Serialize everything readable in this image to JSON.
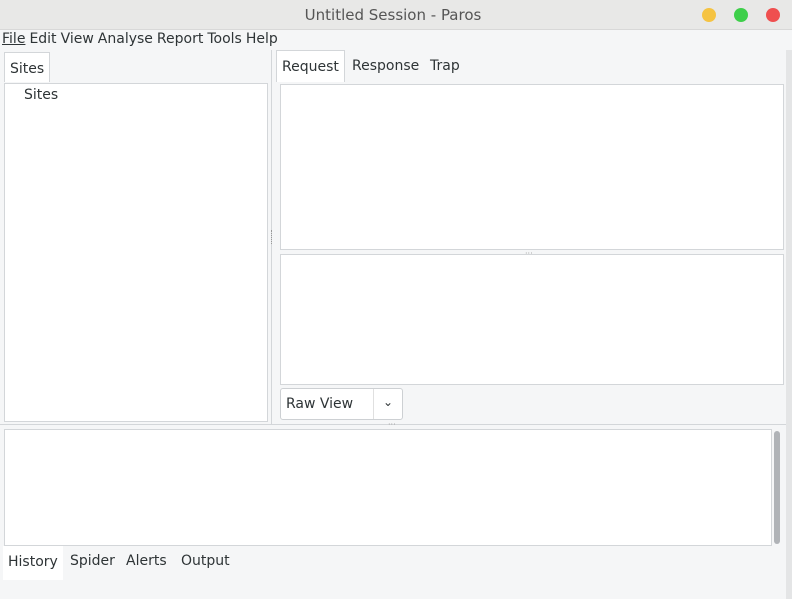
{
  "window": {
    "title": "Untitled Session - Paros",
    "buttons": {
      "minimize": "#f5c342",
      "maximize": "#3ecf4a",
      "close": "#ef4f4f"
    }
  },
  "menu": [
    "File",
    "Edit",
    "View",
    "Analyse",
    "Report",
    "Tools",
    "Help"
  ],
  "left": {
    "tab": "Sites",
    "tree_root": "Sites"
  },
  "right": {
    "tabs": [
      "Request",
      "Response",
      "Trap"
    ],
    "view_select": "Raw View"
  },
  "bottom": {
    "tabs": [
      "History",
      "Spider",
      "Alerts",
      "Output"
    ]
  }
}
